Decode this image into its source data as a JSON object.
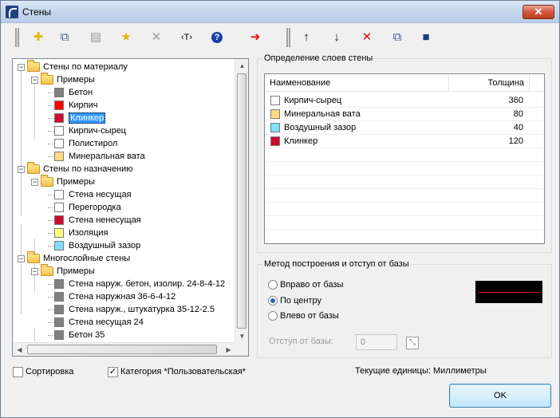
{
  "window": {
    "title": "Стены",
    "close_label": "✕"
  },
  "toolbar": {
    "buttons": [
      {
        "name": "add-button",
        "glyph": "✚",
        "color": "#e0b800"
      },
      {
        "name": "copy-button",
        "glyph": "⧉",
        "color": "#3a5da8"
      },
      {
        "name": "properties-button",
        "glyph": "▤",
        "color": "#9a9a9a"
      },
      {
        "name": "favorite-button",
        "glyph": "★",
        "color": "#e8b400"
      },
      {
        "name": "delete-button",
        "glyph": "✕",
        "color": "#9a9a9a"
      },
      {
        "name": "rename-button",
        "glyph": "‹T›",
        "color": "#000000"
      },
      {
        "name": "help-button",
        "glyph": "?",
        "color": "#1a3fa8"
      },
      {
        "name": "transfer-button",
        "glyph": "➜",
        "color": "#e01010"
      },
      {
        "name": "move-up-button",
        "glyph": "↑",
        "color": "#000000"
      },
      {
        "name": "move-down-button",
        "glyph": "↓",
        "color": "#000000"
      },
      {
        "name": "remove-layer-button",
        "glyph": "✕",
        "color": "#e01010"
      },
      {
        "name": "copy-layer-button",
        "glyph": "⧉",
        "color": "#3a5da8"
      },
      {
        "name": "save-button",
        "glyph": "■",
        "color": "#1d3e7a"
      }
    ]
  },
  "tree": {
    "nodes": [
      {
        "label": "Стены по материалу",
        "type": "folder"
      },
      {
        "label": "Примеры",
        "type": "folder"
      },
      {
        "label": "Бетон",
        "type": "item",
        "color": "#808080"
      },
      {
        "label": "Кирпич",
        "type": "item",
        "color": "#ff0000"
      },
      {
        "label": "Клинкер",
        "type": "item",
        "color": "#d10a2f",
        "selected": true
      },
      {
        "label": "Кирпич-сырец",
        "type": "item",
        "color": "#ffffff"
      },
      {
        "label": "Полистирол",
        "type": "item",
        "color": "#ffffff"
      },
      {
        "label": "Минеральная вата",
        "type": "item",
        "color": "#ffdb80"
      },
      {
        "label": "Стены по назначению",
        "type": "folder"
      },
      {
        "label": "Примеры",
        "type": "folder"
      },
      {
        "label": "Стена несущая",
        "type": "item",
        "color": "#ffffff"
      },
      {
        "label": "Перегородка",
        "type": "item",
        "color": "#ffffff"
      },
      {
        "label": "Стена ненесущая",
        "type": "item",
        "color": "#d10a2f"
      },
      {
        "label": "Изоляция",
        "type": "item",
        "color": "#ffff80"
      },
      {
        "label": "Воздушный зазор",
        "type": "item",
        "color": "#80dfff"
      },
      {
        "label": "Многослойные стены",
        "type": "folder"
      },
      {
        "label": "Примеры",
        "type": "folder"
      },
      {
        "label": "Стена наруж. бетон, изолир. 24-8-4-12",
        "type": "item",
        "color": "#808080"
      },
      {
        "label": "Стена наружная 36-6-4-12",
        "type": "item",
        "color": "#808080"
      },
      {
        "label": "Стена наруж., штукатурка 35-12-2.5",
        "type": "item",
        "color": "#808080"
      },
      {
        "label": "Стена несущая 24",
        "type": "item",
        "color": "#808080"
      },
      {
        "label": "Бетон 35",
        "type": "item",
        "color": "#808080"
      }
    ]
  },
  "layers": {
    "group_title": "Определение слоев стены",
    "col_name": "Наименование",
    "col_thickness": "Толщина",
    "rows": [
      {
        "name": "Кирпич-сырец",
        "thickness": "360",
        "color": "#ffffff"
      },
      {
        "name": "Минеральная вата",
        "thickness": "80",
        "color": "#ffdb80"
      },
      {
        "name": "Воздушный зазор",
        "thickness": "40",
        "color": "#80dfff"
      },
      {
        "name": "Клинкер",
        "thickness": "120",
        "color": "#d10a2f"
      }
    ]
  },
  "method": {
    "group_title": "Метод построения и отступ от базы",
    "options": [
      {
        "label": "Вправо от базы",
        "checked": false
      },
      {
        "label": "По центру",
        "checked": true
      },
      {
        "label": "Влево от базы",
        "checked": false
      }
    ],
    "offset_label": "Отступ от базы:",
    "offset_value": "0"
  },
  "footer": {
    "sort_label": "Сортировка",
    "sort_checked": false,
    "category_label": "Категория *Пользовательская*",
    "category_checked": true,
    "units_text": "Текущие единицы: Миллиметры",
    "ok_label": "OK"
  }
}
